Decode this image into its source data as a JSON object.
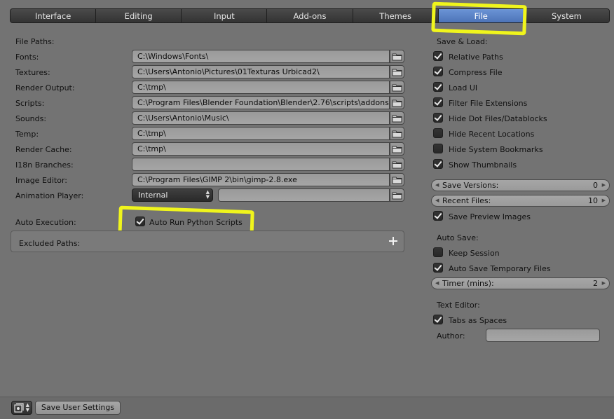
{
  "tabs": [
    {
      "label": "Interface",
      "active": false
    },
    {
      "label": "Editing",
      "active": false
    },
    {
      "label": "Input",
      "active": false
    },
    {
      "label": "Add-ons",
      "active": false
    },
    {
      "label": "Themes",
      "active": false
    },
    {
      "label": "File",
      "active": true
    },
    {
      "label": "System",
      "active": false
    }
  ],
  "file_paths": {
    "heading": "File Paths:",
    "rows": [
      {
        "label": "Fonts:",
        "value": "C:\\Windows\\Fonts\\"
      },
      {
        "label": "Textures:",
        "value": "C:\\Users\\Antonio\\Pictures\\01Texturas Urbicad2\\"
      },
      {
        "label": "Render Output:",
        "value": "C:\\tmp\\"
      },
      {
        "label": "Scripts:",
        "value": "C:\\Program Files\\Blender Foundation\\Blender\\2.76\\scripts\\addons\\"
      },
      {
        "label": "Sounds:",
        "value": "C:\\Users\\Antonio\\Music\\"
      },
      {
        "label": "Temp:",
        "value": "C:\\tmp\\"
      },
      {
        "label": "Render Cache:",
        "value": "C:\\tmp\\"
      },
      {
        "label": "I18n Branches:",
        "value": ""
      },
      {
        "label": "Image Editor:",
        "value": "C:\\Program Files\\GIMP 2\\bin\\gimp-2.8.exe"
      }
    ],
    "animation_player": {
      "label": "Animation Player:",
      "selected": "Internal",
      "path": ""
    }
  },
  "auto_execution": {
    "label": "Auto Execution:",
    "auto_run": {
      "label": "Auto Run Python Scripts",
      "checked": true
    },
    "excluded_paths": "Excluded Paths:"
  },
  "save_load": {
    "heading": "Save & Load:",
    "options": [
      {
        "label": "Relative Paths",
        "checked": true
      },
      {
        "label": "Compress File",
        "checked": true
      },
      {
        "label": "Load UI",
        "checked": true
      },
      {
        "label": "Filter File Extensions",
        "checked": true
      },
      {
        "label": "Hide Dot Files/Datablocks",
        "checked": true
      },
      {
        "label": "Hide Recent Locations",
        "checked": false
      },
      {
        "label": "Hide System Bookmarks",
        "checked": false
      },
      {
        "label": "Show Thumbnails",
        "checked": true
      }
    ],
    "save_versions": {
      "label": "Save Versions:",
      "value": "0"
    },
    "recent_files": {
      "label": "Recent Files:",
      "value": "10"
    },
    "save_preview": {
      "label": "Save Preview Images",
      "checked": true
    }
  },
  "auto_save": {
    "heading": "Auto Save:",
    "keep_session": {
      "label": "Keep Session",
      "checked": false
    },
    "auto_save_temp": {
      "label": "Auto Save Temporary Files",
      "checked": true
    },
    "timer": {
      "label": "Timer (mins):",
      "value": "2"
    }
  },
  "text_editor": {
    "heading": "Text Editor:",
    "tabs_as_spaces": {
      "label": "Tabs as Spaces",
      "checked": true
    },
    "author_label": "Author:",
    "author_value": ""
  },
  "bottom": {
    "save_label": "Save User Settings"
  },
  "colors": {
    "active_tab": "#5b84c9",
    "highlight": "#f0f51c",
    "background": "#737373"
  }
}
